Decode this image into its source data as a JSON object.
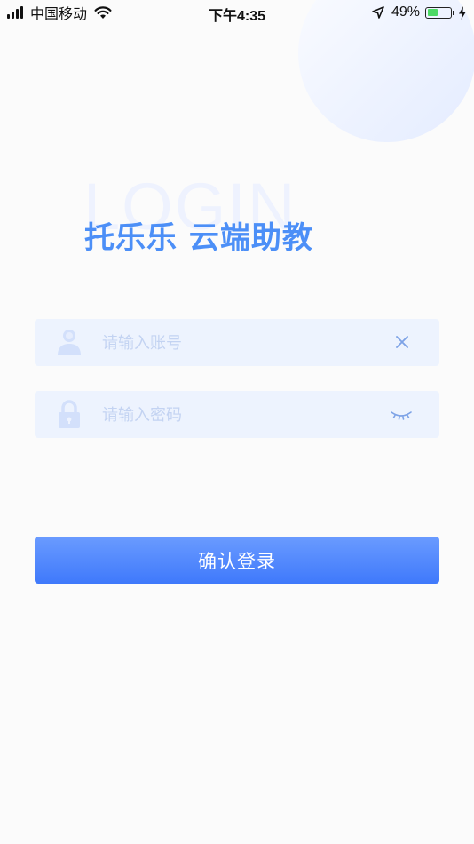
{
  "status_bar": {
    "carrier": "中国移动",
    "time": "下午4:35",
    "battery_percent": "49%",
    "battery_level": 0.49,
    "battery_color": "#4cd964",
    "icons": [
      "signal-icon",
      "wifi-icon",
      "location-arrow-icon",
      "battery-icon",
      "charging-bolt-icon"
    ]
  },
  "header": {
    "watermark": "LOGIN",
    "title": "托乐乐 云端助教"
  },
  "account_field": {
    "placeholder": "请输入账号",
    "value": "",
    "icon": "user-icon",
    "action_icon": "clear-icon"
  },
  "password_field": {
    "placeholder": "请输入密码",
    "value": "",
    "icon": "lock-icon",
    "action_icon": "eye-closed-icon"
  },
  "login_button": {
    "label": "确认登录"
  },
  "colors": {
    "accent": "#4c8ff7",
    "button_top": "#6a9bff",
    "button_bottom": "#3f79fb",
    "field_bg": "#edf3fe",
    "placeholder": "#c3d3f2",
    "background": "#fbfbfb"
  }
}
